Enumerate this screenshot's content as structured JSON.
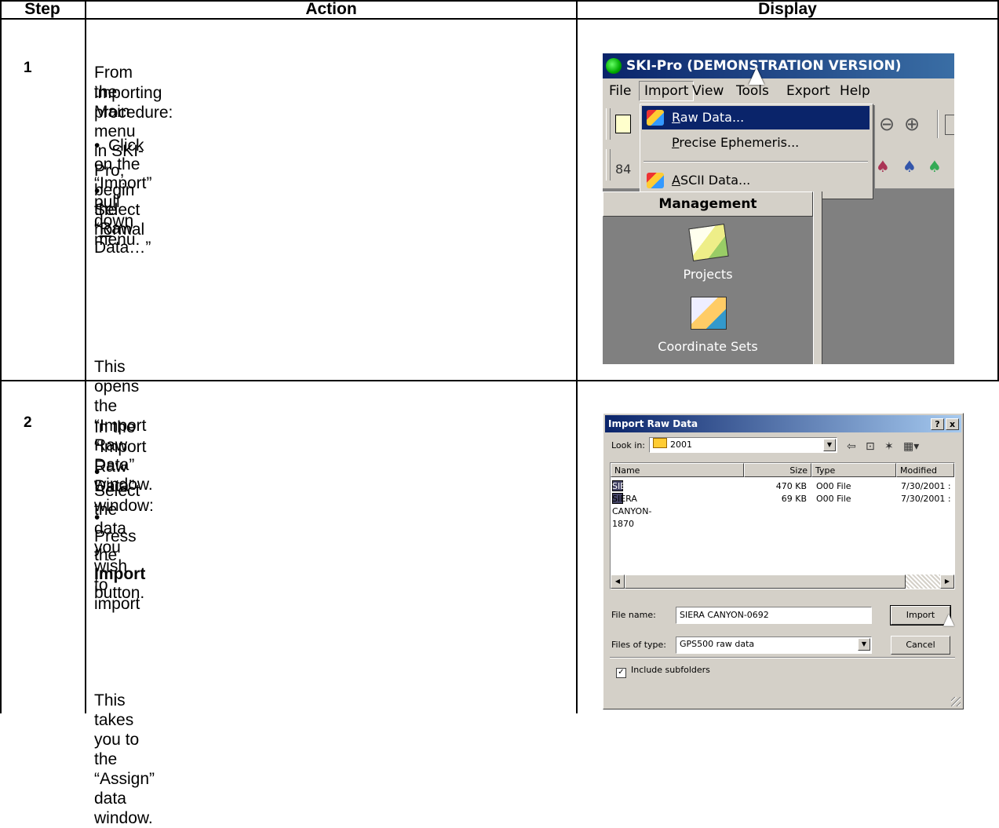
{
  "table": {
    "headers": {
      "step": "Step",
      "action": "Action",
      "display": "Display"
    },
    "rows": [
      {
        "step": "1",
        "intro_line1": "From the Main menu in SKI-Pro, begin the normal",
        "intro_line2": "importing procedure:",
        "bullets": [
          "Click on the “Import” pull down menu."
        ],
        "select_prefix": "Select “",
        "select_underline": "R",
        "select_suffix": "aw Data…”",
        "closing": "This opens the “Import Raw Data” window."
      },
      {
        "step": "2",
        "intro_line1": "In the “Import Raw Data” window:",
        "bullets": [
          "Select the data you wish to import"
        ],
        "press_prefix": "Press the ",
        "press_bold": "Import",
        "press_suffix": " button.",
        "closing": "This takes you to the “Assign” data window."
      }
    ]
  },
  "screenshot1": {
    "title": "SKI-Pro (DEMONSTRATION VERSION)",
    "menubar": [
      "File",
      "Import",
      "View",
      "Tools",
      "Export",
      "Help"
    ],
    "menu_items": [
      {
        "u": "R",
        "rest": "aw Data...",
        "selected": true
      },
      {
        "u": "P",
        "rest": "recise Ephemeris...",
        "selected": false
      },
      {
        "u": "A",
        "rest": "SCII Data...",
        "selected": false
      }
    ],
    "toolbar_text": "84",
    "panel_header": "Management",
    "icons": [
      {
        "label": "Projects",
        "icon": "projects-icon"
      },
      {
        "label": "Coordinate Sets",
        "icon": "coordinate-sets-icon"
      }
    ]
  },
  "dialog": {
    "title": "Import Raw Data",
    "help_label": "?",
    "close_label": "x",
    "look_in_label": "Look in:",
    "look_in_value": "2001",
    "columns": [
      "Name",
      "Size",
      "Type",
      "Modified"
    ],
    "files": [
      {
        "name": "SIERA CANYON-0692",
        "size": "470 KB",
        "type": "O00 File",
        "modified": "7/30/2001 :",
        "selected": true
      },
      {
        "name": "SIERA CANYON-1870",
        "size": "69 KB",
        "type": "O00 File",
        "modified": "7/30/2001 :",
        "selected": false
      }
    ],
    "file_name_label": "File name:",
    "file_name_value": "SIERA CANYON-0692",
    "files_of_type_label": "Files of type:",
    "files_of_type_value": "GPS500 raw data",
    "import_button": "Import",
    "cancel_button": "Cancel",
    "include_subfolders_label": "Include subfolders",
    "include_subfolders_checked": true
  }
}
